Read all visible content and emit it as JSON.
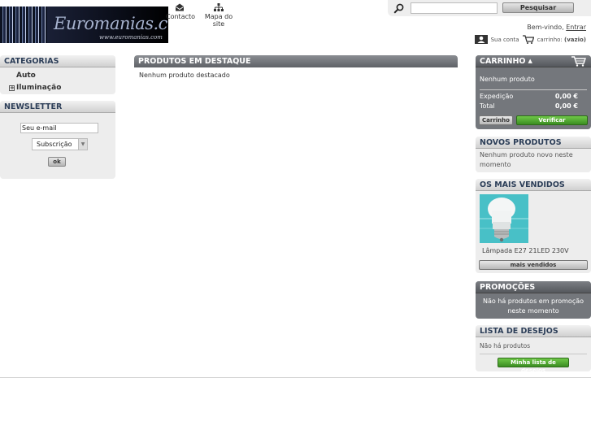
{
  "header": {
    "logo": {
      "wordmark": "Euromanias.com",
      "url_text": "www.euromanias.com"
    },
    "links": {
      "contact": "Contacto",
      "sitemap": "Mapa do site"
    },
    "search": {
      "button": "Pesquisar",
      "value": ""
    },
    "welcome": {
      "text": "Bem-vindo,",
      "login": "Entrar"
    },
    "account": {
      "my_account": "Sua conta",
      "cart_label": "carrinho:",
      "cart_state": "(vazio)"
    }
  },
  "left": {
    "categories": {
      "title": "CATEGORIAS",
      "items": [
        {
          "label": "Auto",
          "expandable": false
        },
        {
          "label": "Iluminação",
          "expandable": true,
          "toggle": "+"
        }
      ]
    },
    "newsletter": {
      "title": "NEWSLETTER",
      "email_value": "Seu e-mail",
      "select_value": "Subscrição",
      "ok": "ok"
    }
  },
  "center": {
    "featured": {
      "title": "PRODUTOS EM DESTAQUE",
      "empty": "Nenhum produto destacado"
    }
  },
  "right": {
    "cart": {
      "title": "CARRINHO",
      "arrow": "▲",
      "empty": "Nenhum produto",
      "shipping_label": "Expedição",
      "shipping_value": "0,00 €",
      "total_label": "Total",
      "total_value": "0,00 €",
      "view_button": "Carrinho",
      "checkout_button": "Verificar"
    },
    "new_products": {
      "title": "NOVOS PRODUTOS",
      "empty": "Nenhum produto novo neste momento"
    },
    "best_sellers": {
      "title": "OS MAIS VENDIDOS",
      "item_name": "Lâmpada E27 21LED 230V",
      "button": "mais vendidos"
    },
    "promotions": {
      "title": "PROMOÇÕES",
      "empty": "Não há produtos em promoção neste momento"
    },
    "wishlist": {
      "title": "LISTA DE DESEJOS",
      "empty": "Não há produtos",
      "button": "Minha lista de desejos"
    }
  },
  "colors": {
    "green_button": "#4aa72d",
    "dark_block": "#74777c",
    "title_blue": "#2c3e58"
  }
}
